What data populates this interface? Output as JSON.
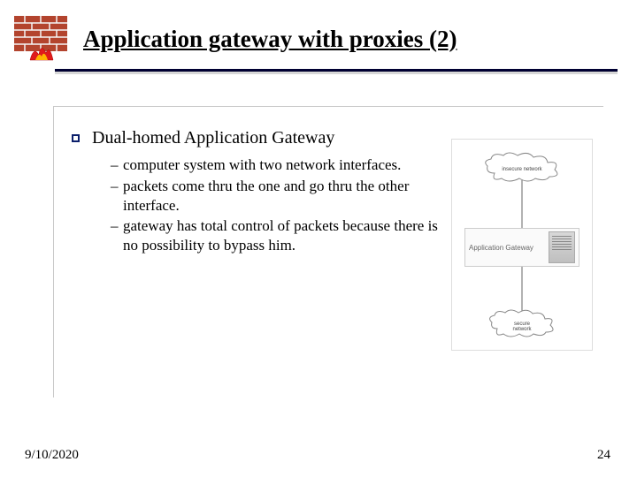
{
  "title": "Application gateway with proxies (2)",
  "main_bullet": "Dual-homed Application Gateway",
  "sub_bullets": [
    "computer system with two network interfaces.",
    "packets come thru the one and go thru the other interface.",
    "gateway has total control of packets because there is no possibility to bypass him."
  ],
  "diagram": {
    "top_cloud": "insecure network",
    "gateway_label": "Application Gateway",
    "bottom_cloud": "secure\nnetwork"
  },
  "footer": {
    "date": "9/10/2020",
    "page": "24"
  }
}
